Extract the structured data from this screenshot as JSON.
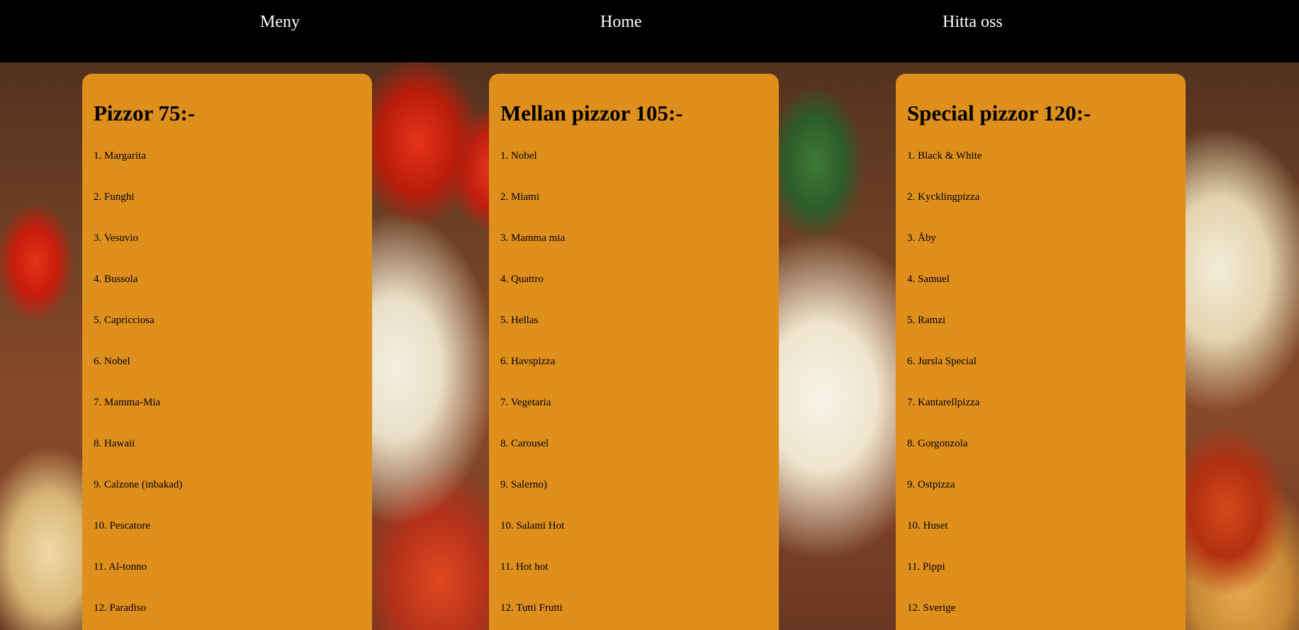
{
  "nav": {
    "items": [
      {
        "label": "Meny"
      },
      {
        "label": "Home"
      },
      {
        "label": "Hitta oss"
      }
    ]
  },
  "menus": [
    {
      "title": "Pizzor 75:-",
      "items": [
        "1. Margarita",
        "2. Funghi",
        "3. Vesuvio",
        "4. Bussola",
        "5. Capricciosa",
        "6. Nobel",
        "7. Mamma-Mia",
        "8. Hawaii",
        "9. Calzone (inbakad)",
        "10. Pescatore",
        "11. Al-tonno",
        "12. Paradiso"
      ]
    },
    {
      "title": "Mellan pizzor 105:-",
      "items": [
        "1. Nobel",
        "2. Miami",
        "3. Mamma mia",
        "4. Quattro",
        "5. Hellas",
        "6. Havspizza",
        "7. Vegetaria",
        "8. Carousel",
        "9. Salerno)",
        "10. Salami Hot",
        "11. Hot hot",
        "12. Tutti Frutti"
      ]
    },
    {
      "title": "Special pizzor 120:-",
      "items": [
        "1. Black & White",
        "2. Kycklingpizza",
        "3. Åby",
        "4. Samuel",
        "5. Ramzi",
        "6. Jursla Special",
        "7. Kantarellpizza",
        "8. Gorgonzola",
        "9. Ostpizza",
        "10. Huset",
        "11. Pippi",
        "12. Sverige"
      ]
    }
  ],
  "colors": {
    "nav_bg": "#000000",
    "nav_text": "#ffffff",
    "card_bg": "#df8f1c",
    "text": "#000000"
  }
}
